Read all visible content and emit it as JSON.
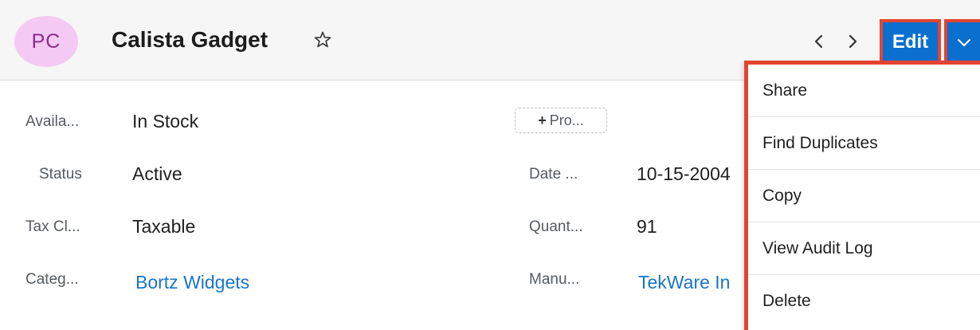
{
  "record": {
    "avatar_initials": "PC",
    "title": "Calista Gadget"
  },
  "toolbar": {
    "edit_label": "Edit"
  },
  "fields": {
    "availability": {
      "label": "Availa...",
      "value": "In Stock"
    },
    "status": {
      "label": "Status",
      "value": "Active"
    },
    "tax_class": {
      "label": "Tax Cl...",
      "value": "Taxable"
    },
    "category": {
      "label": "Categ...",
      "value": "Bortz Widgets"
    },
    "date": {
      "label": "Date ...",
      "value": "10-15-2004"
    },
    "quantity": {
      "label": "Quant...",
      "value": "91"
    },
    "manufacturer": {
      "label": "Manu...",
      "value": "TekWare In"
    }
  },
  "add_field_button": {
    "label": "Pro..."
  },
  "menu": {
    "items": [
      {
        "label": "Share"
      },
      {
        "label": "Find Duplicates"
      },
      {
        "label": "Copy"
      },
      {
        "label": "View Audit Log"
      },
      {
        "label": "Delete"
      }
    ]
  },
  "colors": {
    "primary": "#0a6fcf",
    "highlight": "#e24431",
    "link": "#1a74c8",
    "avatar_bg": "#f4caf4"
  },
  "icons": [
    "star-icon",
    "chevron-left-icon",
    "chevron-right-icon",
    "chevron-down-icon",
    "plus-icon"
  ]
}
